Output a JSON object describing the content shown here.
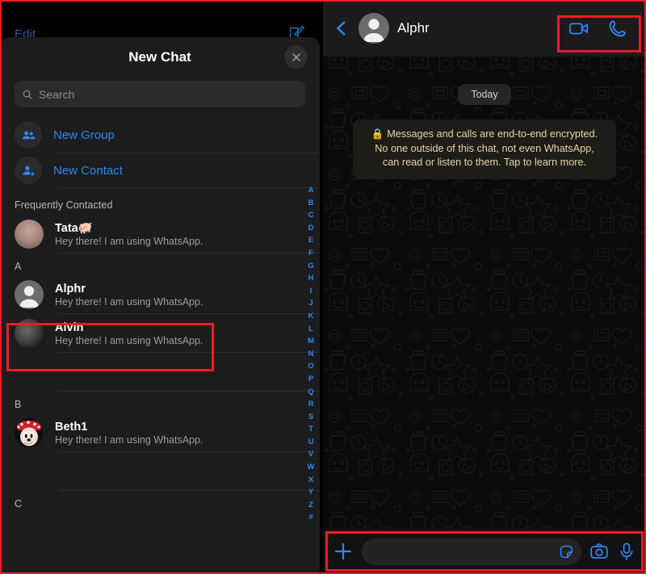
{
  "left_panel": {
    "behind_sheet": {
      "edit_label": "Edit",
      "compose_icon": "compose-icon"
    },
    "sheet": {
      "title": "New Chat",
      "close_icon": "close-icon",
      "search": {
        "icon": "search-icon",
        "placeholder": "Search",
        "value": ""
      },
      "actions": [
        {
          "label": "New Group",
          "icon": "group-people-icon"
        },
        {
          "label": "New Contact",
          "icon": "person-add-icon"
        }
      ],
      "sections": [
        {
          "header": "Frequently Contacted",
          "contacts": [
            {
              "name": "Tata🐖",
              "status": "Hey there! I am using WhatsApp.",
              "avatar": "photo-blurred"
            }
          ]
        },
        {
          "header": "A",
          "contacts": [
            {
              "name": "Alphr",
              "status": "Hey there! I am using WhatsApp.",
              "avatar": "default-person",
              "highlighted": true
            },
            {
              "name": "Alvin",
              "status": "Hey there! I am using WhatsApp.",
              "avatar": "photo-blurred-dark"
            }
          ]
        },
        {
          "header": "B",
          "contacts": [
            {
              "name": "Beth1",
              "status": "Hey there! I am using WhatsApp.",
              "avatar": "minnie-mouse"
            }
          ]
        },
        {
          "header": "C",
          "contacts": []
        }
      ],
      "alphabet_index": [
        "A",
        "B",
        "C",
        "D",
        "E",
        "F",
        "G",
        "H",
        "I",
        "J",
        "K",
        "L",
        "M",
        "N",
        "O",
        "P",
        "Q",
        "R",
        "S",
        "T",
        "U",
        "V",
        "W",
        "X",
        "Y",
        "Z",
        "#"
      ]
    }
  },
  "right_panel": {
    "header": {
      "back_icon": "back-chevron-icon",
      "avatar": "default-person",
      "contact_name": "Alphr",
      "video_call_icon": "video-call-icon",
      "voice_call_icon": "phone-call-icon"
    },
    "conversation": {
      "day_divider": "Today",
      "encryption_notice": {
        "lock_icon": "🔒",
        "text": "Messages and calls are end-to-end encrypted. No one outside of this chat, not even WhatsApp, can read or listen to them. Tap to learn more."
      }
    },
    "input_bar": {
      "plus_icon": "plus-icon",
      "message_placeholder": "",
      "message_value": "",
      "sticker_icon": "sticker-icon",
      "camera_icon": "camera-icon",
      "mic_icon": "microphone-icon"
    }
  },
  "colors": {
    "accent_blue": "#2f89ef",
    "highlight_red": "#ed1c24",
    "encryption_text": "#e4d8a4",
    "sheet_bg": "#1c1c1e"
  }
}
